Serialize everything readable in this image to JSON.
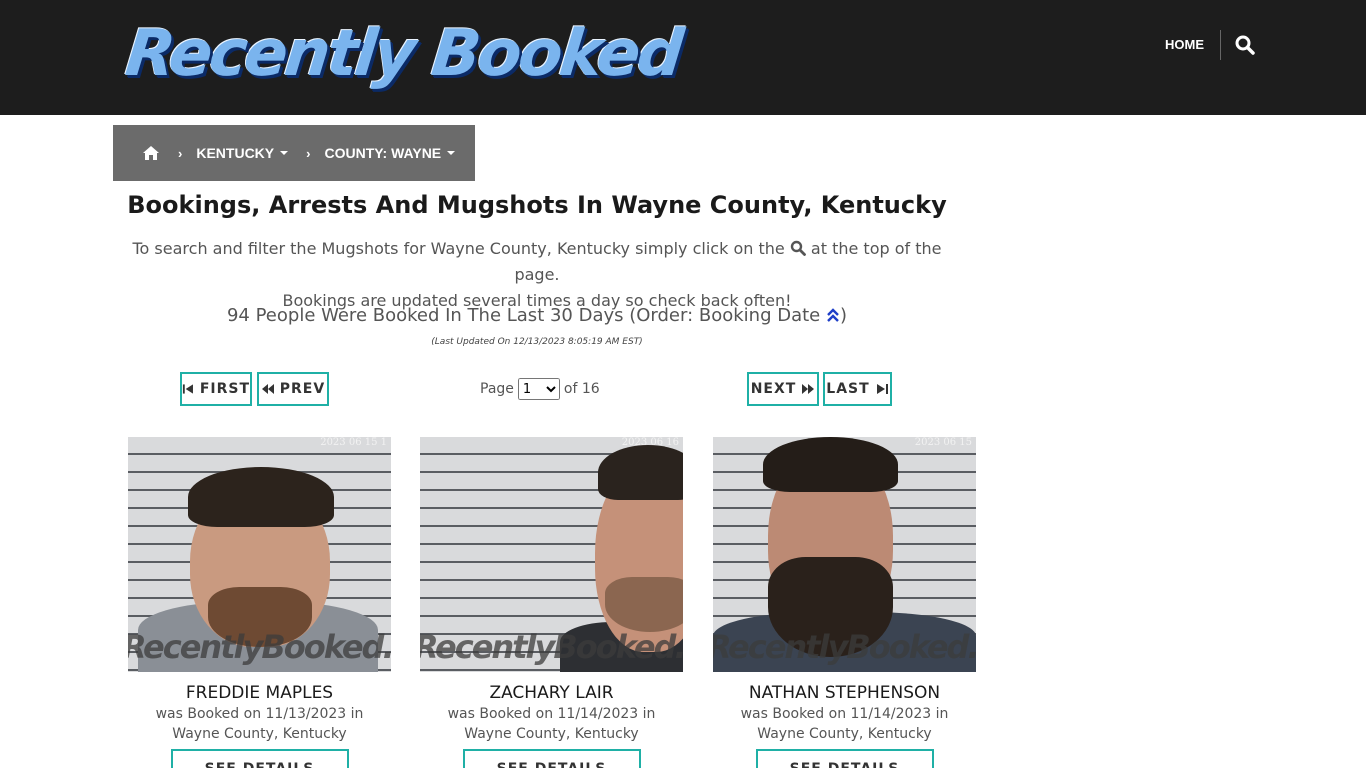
{
  "header": {
    "logo_text": "Recently Booked",
    "nav_home": "HOME",
    "search_icon": "search-icon"
  },
  "breadcrumb": {
    "home_icon": "home-icon",
    "state": "KENTUCKY",
    "county": "COUNTY: WAYNE"
  },
  "page": {
    "title": "Bookings, Arrests And Mugshots In Wayne County, Kentucky",
    "intro_before_icon": "To search and filter the Mugshots for Wayne County, Kentucky simply click on the",
    "intro_after_icon": "at the top of the page.",
    "intro_line2": "Bookings are updated several times a day so check back often!",
    "count_text": "94 People Were Booked In The Last 30 Days (Order: Booking Date",
    "count_close": ")",
    "updated": "(Last Updated On 12/13/2023 8:05:19 AM EST)"
  },
  "pagination": {
    "first": "FIRST",
    "prev": "PREV",
    "next": "NEXT",
    "last": "LAST",
    "page_label": "Page",
    "current_page": "1",
    "of_label": "of 16"
  },
  "bookings": [
    {
      "name": "FREDDIE MAPLES",
      "booked_line": "was Booked on 11/13/2023 in",
      "location": "Wayne County, Kentucky",
      "stamp": "2023 06 15 1",
      "watermark": "RecentlyBooked.com",
      "details": "SEE DETAILS"
    },
    {
      "name": "ZACHARY LAIR",
      "booked_line": "was Booked on 11/14/2023 in",
      "location": "Wayne County, Kentucky",
      "stamp": "2023 06 16",
      "watermark": "RecentlyBooked.com",
      "details": "SEE DETAILS"
    },
    {
      "name": "NATHAN STEPHENSON",
      "booked_line": "was Booked on 11/14/2023 in",
      "location": "Wayne County, Kentucky",
      "stamp": "2023 06 15",
      "watermark": "RecentlyBooked.com",
      "details": "SEE DETAILS"
    }
  ],
  "colors": {
    "header_bg": "#1d1d1d",
    "breadcrumb_bg": "#6b6b6b",
    "accent_teal": "#1fb0a6",
    "sort_icon_blue": "#1e3fc8"
  }
}
